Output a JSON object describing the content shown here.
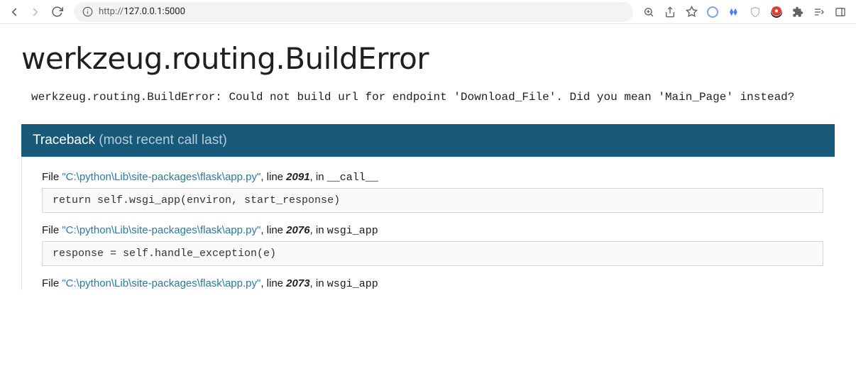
{
  "browser": {
    "url_proto": "http://",
    "url_rest": "127.0.0.1:5000"
  },
  "error": {
    "title": "werkzeug.routing.BuildError",
    "message": "werkzeug.routing.BuildError: Could not build url for endpoint 'Download_File'. Did you mean 'Main_Page' instead?"
  },
  "traceback": {
    "header_label": "Traceback",
    "header_sub": "(most recent call last)",
    "file_prefix": "File ",
    "line_prefix": ", line ",
    "in_prefix": ", in ",
    "frames": [
      {
        "file": "\"C:\\python\\Lib\\site-packages\\flask\\app.py\"",
        "line": "2091",
        "fn": "__call__",
        "code": "return self.wsgi_app(environ, start_response)"
      },
      {
        "file": "\"C:\\python\\Lib\\site-packages\\flask\\app.py\"",
        "line": "2076",
        "fn": "wsgi_app",
        "code": "response = self.handle_exception(e)"
      },
      {
        "file": "\"C:\\python\\Lib\\site-packages\\flask\\app.py\"",
        "line": "2073",
        "fn": "wsgi_app",
        "code": ""
      }
    ]
  }
}
